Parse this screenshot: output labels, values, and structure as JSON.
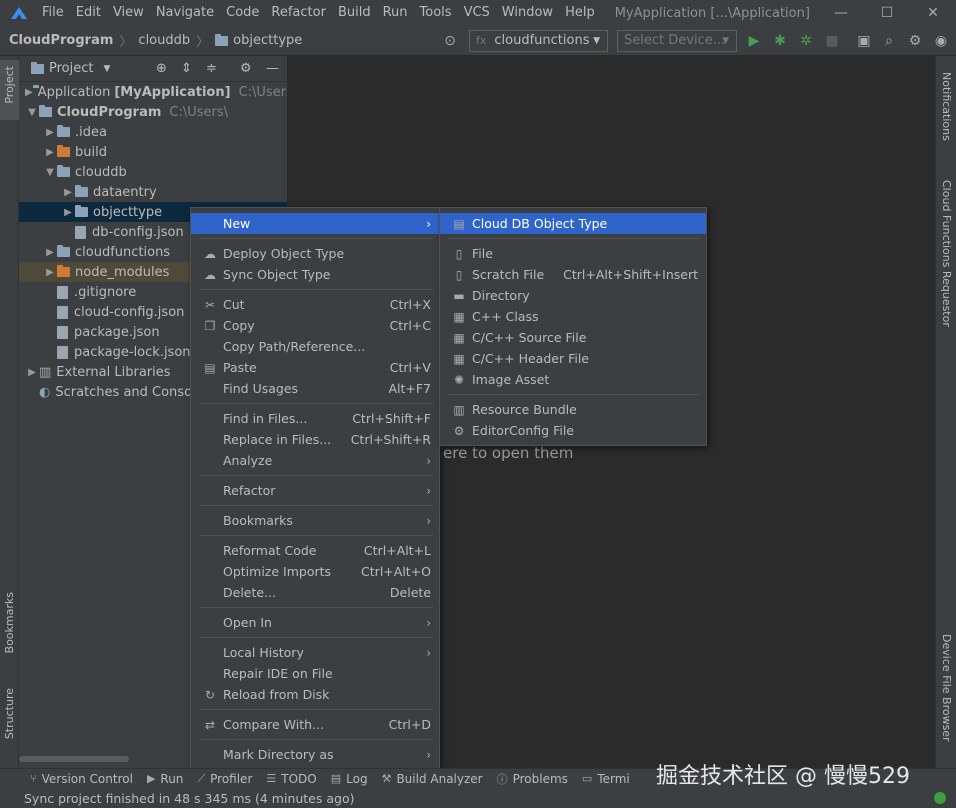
{
  "window": {
    "title": "MyApplication [...\\Application]",
    "menu": [
      "File",
      "Edit",
      "View",
      "Navigate",
      "Code",
      "Refactor",
      "Build",
      "Run",
      "Tools",
      "VCS",
      "Window",
      "Help"
    ]
  },
  "navbar": {
    "breadcrumbs": [
      "CloudProgram",
      "clouddb",
      "objecttype"
    ],
    "run_config": "cloudfunctions",
    "run_config_prefix": "fx",
    "device_select": "Select Device..."
  },
  "project_panel": {
    "title": "Project",
    "tree": [
      {
        "label": "Application",
        "bold": "[MyApplication]",
        "path": "C:\\Users\\",
        "level": 0,
        "expand": "collapsed",
        "kind": "module"
      },
      {
        "label": "CloudProgram",
        "bold": "",
        "path": "C:\\Users\\",
        "level": 0,
        "expand": "expanded",
        "kind": "module"
      },
      {
        "label": ".idea",
        "level": 1,
        "expand": "collapsed",
        "kind": "folder"
      },
      {
        "label": "build",
        "level": 1,
        "expand": "collapsed",
        "kind": "folder-orange"
      },
      {
        "label": "clouddb",
        "level": 1,
        "expand": "expanded",
        "kind": "folder-blue"
      },
      {
        "label": "dataentry",
        "level": 2,
        "expand": "collapsed",
        "kind": "folder"
      },
      {
        "label": "objecttype",
        "level": 2,
        "expand": "collapsed",
        "kind": "folder",
        "selected": true
      },
      {
        "label": "db-config.json",
        "level": 2,
        "expand": "none",
        "kind": "file"
      },
      {
        "label": "cloudfunctions",
        "level": 1,
        "expand": "collapsed",
        "kind": "folder-blue"
      },
      {
        "label": "node_modules",
        "level": 1,
        "expand": "collapsed",
        "kind": "folder-orange",
        "highlight": true
      },
      {
        "label": ".gitignore",
        "level": 1,
        "expand": "none",
        "kind": "file"
      },
      {
        "label": "cloud-config.json",
        "level": 1,
        "expand": "none",
        "kind": "file"
      },
      {
        "label": "package.json",
        "level": 1,
        "expand": "none",
        "kind": "file"
      },
      {
        "label": "package-lock.json",
        "level": 1,
        "expand": "none",
        "kind": "file"
      },
      {
        "label": "External Libraries",
        "level": 0,
        "expand": "collapsed",
        "kind": "libs"
      },
      {
        "label": "Scratches and Console",
        "level": 0,
        "expand": "none",
        "kind": "scratch"
      }
    ]
  },
  "left_tools": {
    "project": "Project",
    "bookmarks": "Bookmarks",
    "structure": "Structure"
  },
  "right_tools": {
    "notifications": "Notifications",
    "cloud_functions": "Cloud Functions Requestor",
    "device_file": "Device File Browser"
  },
  "editor": {
    "hint": "ere to open them"
  },
  "context_menu": {
    "items": [
      {
        "label": "New",
        "arrow": true,
        "active": true
      },
      {
        "sep": true
      },
      {
        "label": "Deploy Object Type",
        "icon": "cloud-upload-icon"
      },
      {
        "label": "Sync Object Type",
        "icon": "cloud-sync-icon"
      },
      {
        "sep": true
      },
      {
        "label": "Cut",
        "shortcut": "Ctrl+X",
        "icon": "scissors-icon"
      },
      {
        "label": "Copy",
        "shortcut": "Ctrl+C",
        "icon": "copy-icon"
      },
      {
        "label": "Copy Path/Reference..."
      },
      {
        "label": "Paste",
        "shortcut": "Ctrl+V",
        "icon": "clipboard-icon"
      },
      {
        "label": "Find Usages",
        "shortcut": "Alt+F7"
      },
      {
        "sep": true
      },
      {
        "label": "Find in Files...",
        "shortcut": "Ctrl+Shift+F"
      },
      {
        "label": "Replace in Files...",
        "shortcut": "Ctrl+Shift+R"
      },
      {
        "label": "Analyze",
        "arrow": true
      },
      {
        "sep": true
      },
      {
        "label": "Refactor",
        "arrow": true
      },
      {
        "sep": true
      },
      {
        "label": "Bookmarks",
        "arrow": true
      },
      {
        "sep": true
      },
      {
        "label": "Reformat Code",
        "shortcut": "Ctrl+Alt+L"
      },
      {
        "label": "Optimize Imports",
        "shortcut": "Ctrl+Alt+O"
      },
      {
        "label": "Delete...",
        "shortcut": "Delete"
      },
      {
        "sep": true
      },
      {
        "label": "Open In",
        "arrow": true
      },
      {
        "sep": true
      },
      {
        "label": "Local History",
        "arrow": true
      },
      {
        "label": "Repair IDE on File"
      },
      {
        "label": "Reload from Disk",
        "icon": "reload-icon"
      },
      {
        "sep": true
      },
      {
        "label": "Compare With...",
        "shortcut": "Ctrl+D",
        "icon": "compare-icon"
      },
      {
        "sep": true
      },
      {
        "label": "Mark Directory as",
        "arrow": true
      }
    ]
  },
  "submenu": {
    "items": [
      {
        "label": "Cloud DB Object Type",
        "active": true,
        "icon": "table-icon"
      },
      {
        "sep": true
      },
      {
        "label": "File",
        "icon": "file-icon"
      },
      {
        "label": "Scratch File",
        "shortcut": "Ctrl+Alt+Shift+Insert",
        "icon": "scratch-file-icon"
      },
      {
        "label": "Directory",
        "icon": "folder-icon"
      },
      {
        "label": "C++ Class",
        "icon": "cpp-class-icon"
      },
      {
        "label": "C/C++ Source File",
        "icon": "cpp-source-icon"
      },
      {
        "label": "C/C++ Header File",
        "icon": "cpp-header-icon"
      },
      {
        "label": "Image Asset",
        "icon": "image-asset-icon"
      },
      {
        "sep": true
      },
      {
        "label": "Resource Bundle",
        "icon": "resource-bundle-icon"
      },
      {
        "label": "EditorConfig File",
        "icon": "gear-icon"
      }
    ]
  },
  "statusbar": {
    "tabs": [
      "Version Control",
      "Run",
      "Profiler",
      "TODO",
      "Log",
      "Build Analyzer",
      "Problems",
      "Termi"
    ],
    "message": "Sync project finished in 48 s 345 ms (4 minutes ago)",
    "watermark": "掘金技术社区 @ 慢慢529"
  }
}
